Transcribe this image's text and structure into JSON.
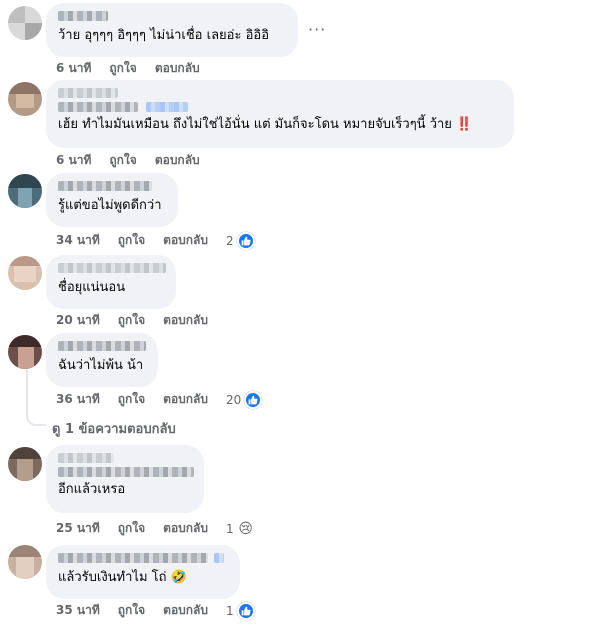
{
  "comments": [
    {
      "text": "ว้าย อุๆๆๆ อิๆๆๆ ไม่น่าเชื่อ เลยอ่ะ อิอิอิ",
      "time": "6 นาที",
      "like": "ถูกใจ",
      "reply": "ตอบกลับ",
      "reaction_count": "",
      "more": "···"
    },
    {
      "text": "เฮ้ย ทำไมมันเหมือน ถึงไม่ใช่ไอ้นั่น แต่ มันก็จะโดน หมายจับเร็วๆนี้ ว้าย",
      "emoji": "‼️",
      "time": "6 นาที",
      "like": "ถูกใจ",
      "reply": "ตอบกลับ",
      "reaction_count": ""
    },
    {
      "text": "รู้แต่ขอไม่พูดดีกว่า",
      "time": "34 นาที",
      "like": "ถูกใจ",
      "reply": "ตอบกลับ",
      "reaction_count": "2",
      "reaction_icon": "like-icon"
    },
    {
      "text": "ชื่อยุแน่นอน",
      "time": "20 นาที",
      "like": "ถูกใจ",
      "reply": "ตอบกลับ",
      "reaction_count": ""
    },
    {
      "text": "ฉันว่าไม่พ้น น้า",
      "time": "36 นาที",
      "like": "ถูกใจ",
      "reply": "ตอบกลับ",
      "reaction_count": "20",
      "reaction_icon": "like-icon",
      "replies_link": "ดู 1 ข้อความตอบกลับ"
    },
    {
      "text": "อีกแล้วเหรอ",
      "time": "25 นาที",
      "like": "ถูกใจ",
      "reply": "ตอบกลับ",
      "reaction_count": "1",
      "reaction_icon": "sad-icon",
      "reaction_emoji": "😢"
    },
    {
      "text": "แล้วรับเงินทำไม โถ่",
      "emoji": "🤣",
      "time": "35 นาที",
      "like": "ถูกใจ",
      "reply": "ตอบกลับ",
      "reaction_count": "1",
      "reaction_icon": "like-icon"
    }
  ],
  "colors": {
    "bubble": "#f0f2f5",
    "meta": "#65676b",
    "like_blue": "#1877f2",
    "alert_red": "#e41e3f"
  }
}
